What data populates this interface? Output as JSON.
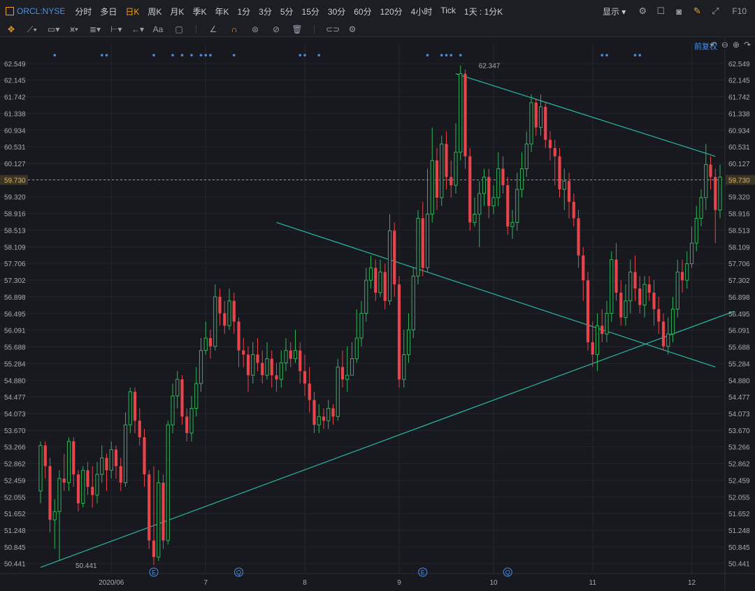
{
  "toolbar": {
    "symbol": "ORCL:NYSE",
    "periods": [
      "分时",
      "多日",
      "日K",
      "周K",
      "月K",
      "季K",
      "年K",
      "1分",
      "3分",
      "5分",
      "15分",
      "30分",
      "60分",
      "120分",
      "4小时",
      "Tick",
      "1天 : 1分K"
    ],
    "active_period": "日K",
    "display_label": "显示",
    "f10_label": "F10",
    "text_tool_label": "Aa",
    "fuquan_label": "前复权"
  },
  "colors": {
    "background": "#17191f",
    "up": "#2fb35a",
    "down": "#e8444b",
    "trendline": "#2ab7a3",
    "current_price_line": "#d8b46a",
    "accent": "#f0a020",
    "link": "#4d8fe6"
  },
  "chart_data": {
    "type": "candlestick",
    "symbol": "ORCL:NYSE",
    "y_axis_ticks": [
      "62.549",
      "62.145",
      "61.742",
      "61.338",
      "60.934",
      "60.531",
      "60.127",
      "59.730",
      "59.320",
      "58.916",
      "58.513",
      "58.109",
      "57.706",
      "57.302",
      "56.898",
      "56.495",
      "56.091",
      "55.688",
      "55.284",
      "54.880",
      "54.477",
      "54.073",
      "53.670",
      "53.266",
      "52.862",
      "52.459",
      "52.055",
      "51.652",
      "51.248",
      "50.845",
      "50.441"
    ],
    "ylim": [
      50.2,
      62.85
    ],
    "current_price": 59.73,
    "current_price_label": "59.730",
    "max_label": "62.347",
    "min_label": "50.441",
    "x_labels": [
      {
        "label": "2020/06",
        "index": 15
      },
      {
        "label": "7",
        "index": 35
      },
      {
        "label": "8",
        "index": 56
      },
      {
        "label": "9",
        "index": 76
      },
      {
        "label": "10",
        "index": 96
      },
      {
        "label": "11",
        "index": 117
      },
      {
        "label": "12",
        "index": 138
      }
    ],
    "event_markers": [
      {
        "type": "E",
        "index": 24
      },
      {
        "type": "Q",
        "index": 42
      },
      {
        "type": "E",
        "index": 81
      },
      {
        "type": "Q",
        "index": 99
      }
    ],
    "dividend_dot_indices": [
      3,
      13,
      14,
      24,
      28,
      30,
      32,
      34,
      35,
      36,
      41,
      55,
      56,
      59,
      82,
      85,
      86,
      87,
      89,
      119,
      120,
      126,
      127
    ],
    "trendlines": [
      {
        "name": "upper-resistance",
        "points": [
          [
            88,
            62.3
          ],
          [
            143,
            60.3
          ]
        ]
      },
      {
        "name": "middle-line",
        "points": [
          [
            50,
            58.7
          ],
          [
            143,
            55.2
          ]
        ]
      },
      {
        "name": "lower-support",
        "points": [
          [
            0,
            50.35
          ],
          [
            147,
            56.55
          ]
        ]
      }
    ],
    "candles": [
      [
        52.2,
        53.3,
        53.4,
        51.9
      ],
      [
        53.3,
        52.8,
        53.4,
        52.5
      ],
      [
        52.8,
        51.5,
        53.0,
        51.2
      ],
      [
        51.5,
        51.7,
        52.0,
        50.8
      ],
      [
        51.7,
        52.5,
        52.7,
        50.5
      ],
      [
        52.5,
        52.4,
        53.1,
        52.2
      ],
      [
        52.4,
        53.4,
        53.5,
        52.2
      ],
      [
        53.4,
        52.6,
        53.5,
        52.3
      ],
      [
        52.6,
        51.9,
        52.7,
        51.7
      ],
      [
        51.9,
        52.7,
        52.8,
        51.8
      ],
      [
        52.7,
        52.3,
        52.9,
        52.1
      ],
      [
        52.3,
        52.1,
        52.8,
        51.8
      ],
      [
        52.1,
        52.6,
        52.9,
        51.9
      ],
      [
        52.6,
        53.0,
        53.3,
        52.4
      ],
      [
        53.0,
        52.7,
        53.1,
        52.2
      ],
      [
        52.7,
        53.2,
        53.4,
        52.5
      ],
      [
        53.2,
        52.8,
        53.3,
        52.5
      ],
      [
        52.8,
        52.4,
        53.0,
        52.2
      ],
      [
        52.4,
        53.8,
        54.1,
        52.3
      ],
      [
        53.8,
        54.6,
        54.7,
        53.6
      ],
      [
        54.6,
        53.9,
        54.7,
        53.6
      ],
      [
        53.9,
        53.5,
        54.2,
        53.3
      ],
      [
        53.5,
        52.6,
        53.7,
        52.3
      ],
      [
        52.6,
        51.0,
        52.7,
        50.8
      ],
      [
        51.0,
        50.6,
        52.8,
        50.4
      ],
      [
        50.6,
        52.4,
        52.7,
        50.5
      ],
      [
        52.4,
        51.0,
        52.6,
        50.8
      ],
      [
        51.0,
        53.8,
        53.9,
        50.9
      ],
      [
        53.8,
        54.5,
        54.8,
        53.6
      ],
      [
        54.5,
        54.9,
        55.1,
        54.2
      ],
      [
        54.9,
        54.0,
        55.0,
        53.8
      ],
      [
        54.0,
        53.6,
        54.2,
        53.4
      ],
      [
        53.6,
        54.2,
        54.5,
        53.4
      ],
      [
        54.2,
        54.8,
        55.2,
        54.0
      ],
      [
        54.8,
        55.6,
        55.9,
        54.6
      ],
      [
        55.6,
        55.9,
        56.3,
        55.5
      ],
      [
        55.9,
        55.7,
        56.1,
        55.4
      ],
      [
        55.7,
        56.9,
        57.2,
        55.6
      ],
      [
        56.9,
        56.5,
        57.1,
        56.2
      ],
      [
        56.5,
        56.2,
        56.8,
        56.0
      ],
      [
        56.2,
        56.8,
        57.1,
        56.1
      ],
      [
        56.8,
        56.3,
        57.0,
        56.0
      ],
      [
        56.3,
        55.6,
        56.4,
        55.2
      ],
      [
        55.6,
        55.5,
        55.9,
        55.2
      ],
      [
        55.5,
        55.0,
        55.7,
        54.6
      ],
      [
        55.0,
        55.5,
        55.8,
        54.8
      ],
      [
        55.5,
        55.3,
        55.9,
        55.1
      ],
      [
        55.3,
        55.0,
        55.6,
        54.8
      ],
      [
        55.0,
        55.4,
        55.8,
        54.9
      ],
      [
        55.4,
        55.0,
        55.6,
        54.7
      ],
      [
        55.0,
        54.9,
        55.3,
        54.6
      ],
      [
        54.9,
        55.3,
        55.6,
        54.7
      ],
      [
        55.3,
        55.6,
        55.9,
        55.1
      ],
      [
        55.6,
        55.4,
        55.8,
        55.2
      ],
      [
        55.4,
        55.6,
        56.1,
        55.3
      ],
      [
        55.6,
        55.1,
        55.8,
        54.8
      ],
      [
        55.1,
        54.8,
        55.5,
        54.5
      ],
      [
        54.8,
        54.4,
        55.2,
        54.1
      ],
      [
        54.4,
        53.8,
        54.6,
        53.6
      ],
      [
        53.8,
        54.0,
        54.3,
        53.6
      ],
      [
        54.0,
        53.9,
        54.2,
        53.7
      ],
      [
        53.9,
        54.2,
        54.4,
        53.7
      ],
      [
        54.2,
        54.0,
        54.3,
        53.8
      ],
      [
        54.0,
        55.2,
        55.4,
        53.9
      ],
      [
        55.2,
        54.9,
        55.6,
        54.7
      ],
      [
        54.9,
        55.0,
        55.7,
        54.6
      ],
      [
        55.0,
        55.4,
        55.8,
        55.0
      ],
      [
        55.4,
        55.9,
        56.6,
        55.3
      ],
      [
        55.9,
        56.5,
        56.8,
        55.7
      ],
      [
        56.5,
        57.3,
        57.6,
        56.3
      ],
      [
        57.3,
        57.6,
        57.9,
        57.1
      ],
      [
        57.6,
        57.0,
        57.8,
        56.8
      ],
      [
        57.0,
        57.5,
        57.8,
        56.9
      ],
      [
        57.5,
        56.8,
        57.7,
        56.6
      ],
      [
        56.8,
        58.5,
        58.9,
        56.7
      ],
      [
        58.5,
        57.2,
        58.7,
        56.9
      ],
      [
        57.2,
        54.9,
        57.4,
        54.7
      ],
      [
        54.9,
        55.5,
        56.1,
        54.7
      ],
      [
        55.5,
        56.1,
        56.5,
        55.3
      ],
      [
        56.1,
        57.4,
        57.6,
        55.9
      ],
      [
        57.4,
        58.8,
        59.0,
        57.2
      ],
      [
        58.8,
        57.6,
        59.2,
        57.4
      ],
      [
        57.6,
        58.9,
        60.0,
        57.5
      ],
      [
        58.9,
        60.2,
        61.0,
        58.7
      ],
      [
        60.2,
        59.3,
        60.5,
        59.0
      ],
      [
        59.3,
        60.6,
        60.8,
        59.1
      ],
      [
        60.6,
        59.8,
        60.9,
        59.5
      ],
      [
        59.8,
        59.6,
        60.2,
        59.3
      ],
      [
        59.6,
        60.4,
        61.1,
        59.4
      ],
      [
        60.4,
        62.3,
        62.5,
        60.2
      ],
      [
        62.3,
        60.3,
        62.4,
        60.0
      ],
      [
        60.3,
        58.7,
        60.5,
        58.5
      ],
      [
        58.7,
        58.9,
        59.3,
        58.6
      ],
      [
        58.9,
        59.4,
        59.7,
        58.1
      ],
      [
        59.4,
        59.8,
        60.0,
        59.1
      ],
      [
        59.8,
        59.1,
        60.0,
        58.8
      ],
      [
        59.1,
        59.3,
        59.6,
        58.9
      ],
      [
        59.3,
        60.0,
        60.4,
        59.1
      ],
      [
        60.0,
        59.6,
        60.3,
        59.4
      ],
      [
        59.6,
        58.6,
        59.8,
        58.4
      ],
      [
        58.6,
        58.7,
        59.0,
        58.3
      ],
      [
        58.7,
        59.5,
        59.9,
        58.5
      ],
      [
        59.5,
        60.0,
        60.4,
        59.3
      ],
      [
        60.0,
        60.6,
        60.9,
        59.8
      ],
      [
        60.6,
        61.6,
        61.8,
        60.4
      ],
      [
        61.6,
        61.0,
        61.7,
        60.8
      ],
      [
        61.0,
        61.5,
        61.8,
        60.8
      ],
      [
        61.5,
        60.7,
        61.6,
        60.5
      ],
      [
        60.7,
        60.5,
        60.9,
        60.2
      ],
      [
        60.5,
        60.3,
        60.7,
        59.6
      ],
      [
        60.3,
        59.5,
        60.5,
        59.3
      ],
      [
        59.5,
        59.7,
        60.0,
        59.0
      ],
      [
        59.7,
        59.2,
        59.9,
        58.8
      ],
      [
        59.2,
        58.8,
        59.4,
        58.6
      ],
      [
        58.8,
        57.9,
        59.0,
        57.6
      ],
      [
        57.9,
        57.3,
        58.1,
        56.8
      ],
      [
        57.3,
        55.8,
        57.5,
        55.6
      ],
      [
        55.8,
        55.5,
        56.3,
        55.2
      ],
      [
        55.5,
        56.2,
        56.5,
        55.1
      ],
      [
        56.2,
        56.0,
        56.6,
        55.8
      ],
      [
        56.0,
        56.5,
        56.8,
        55.8
      ],
      [
        56.5,
        57.8,
        58.0,
        56.3
      ],
      [
        57.8,
        57.0,
        58.2,
        56.8
      ],
      [
        57.0,
        56.4,
        57.3,
        56.2
      ],
      [
        56.4,
        56.8,
        57.2,
        56.2
      ],
      [
        56.8,
        57.5,
        57.8,
        56.5
      ],
      [
        57.5,
        57.1,
        57.9,
        56.8
      ],
      [
        57.1,
        56.7,
        57.4,
        56.5
      ],
      [
        56.7,
        57.2,
        57.4,
        56.4
      ],
      [
        57.2,
        57.0,
        57.4,
        56.8
      ],
      [
        57.0,
        56.6,
        57.3,
        56.2
      ],
      [
        56.6,
        56.3,
        56.9,
        56.0
      ],
      [
        56.3,
        55.7,
        56.5,
        55.6
      ],
      [
        55.7,
        56.0,
        56.4,
        55.5
      ],
      [
        56.0,
        56.6,
        56.9,
        55.8
      ],
      [
        56.6,
        57.5,
        57.8,
        56.4
      ],
      [
        57.5,
        57.3,
        57.8,
        57.0
      ],
      [
        57.3,
        57.7,
        58.0,
        57.1
      ],
      [
        57.7,
        58.2,
        58.6,
        57.6
      ],
      [
        58.2,
        58.8,
        59.1,
        58.0
      ],
      [
        58.8,
        59.3,
        59.5,
        58.6
      ],
      [
        59.3,
        60.1,
        60.6,
        59.0
      ],
      [
        60.1,
        59.8,
        60.3,
        59.5
      ],
      [
        59.8,
        59.0,
        60.0,
        58.2
      ],
      [
        59.0,
        59.8,
        60.1,
        58.8
      ]
    ]
  }
}
